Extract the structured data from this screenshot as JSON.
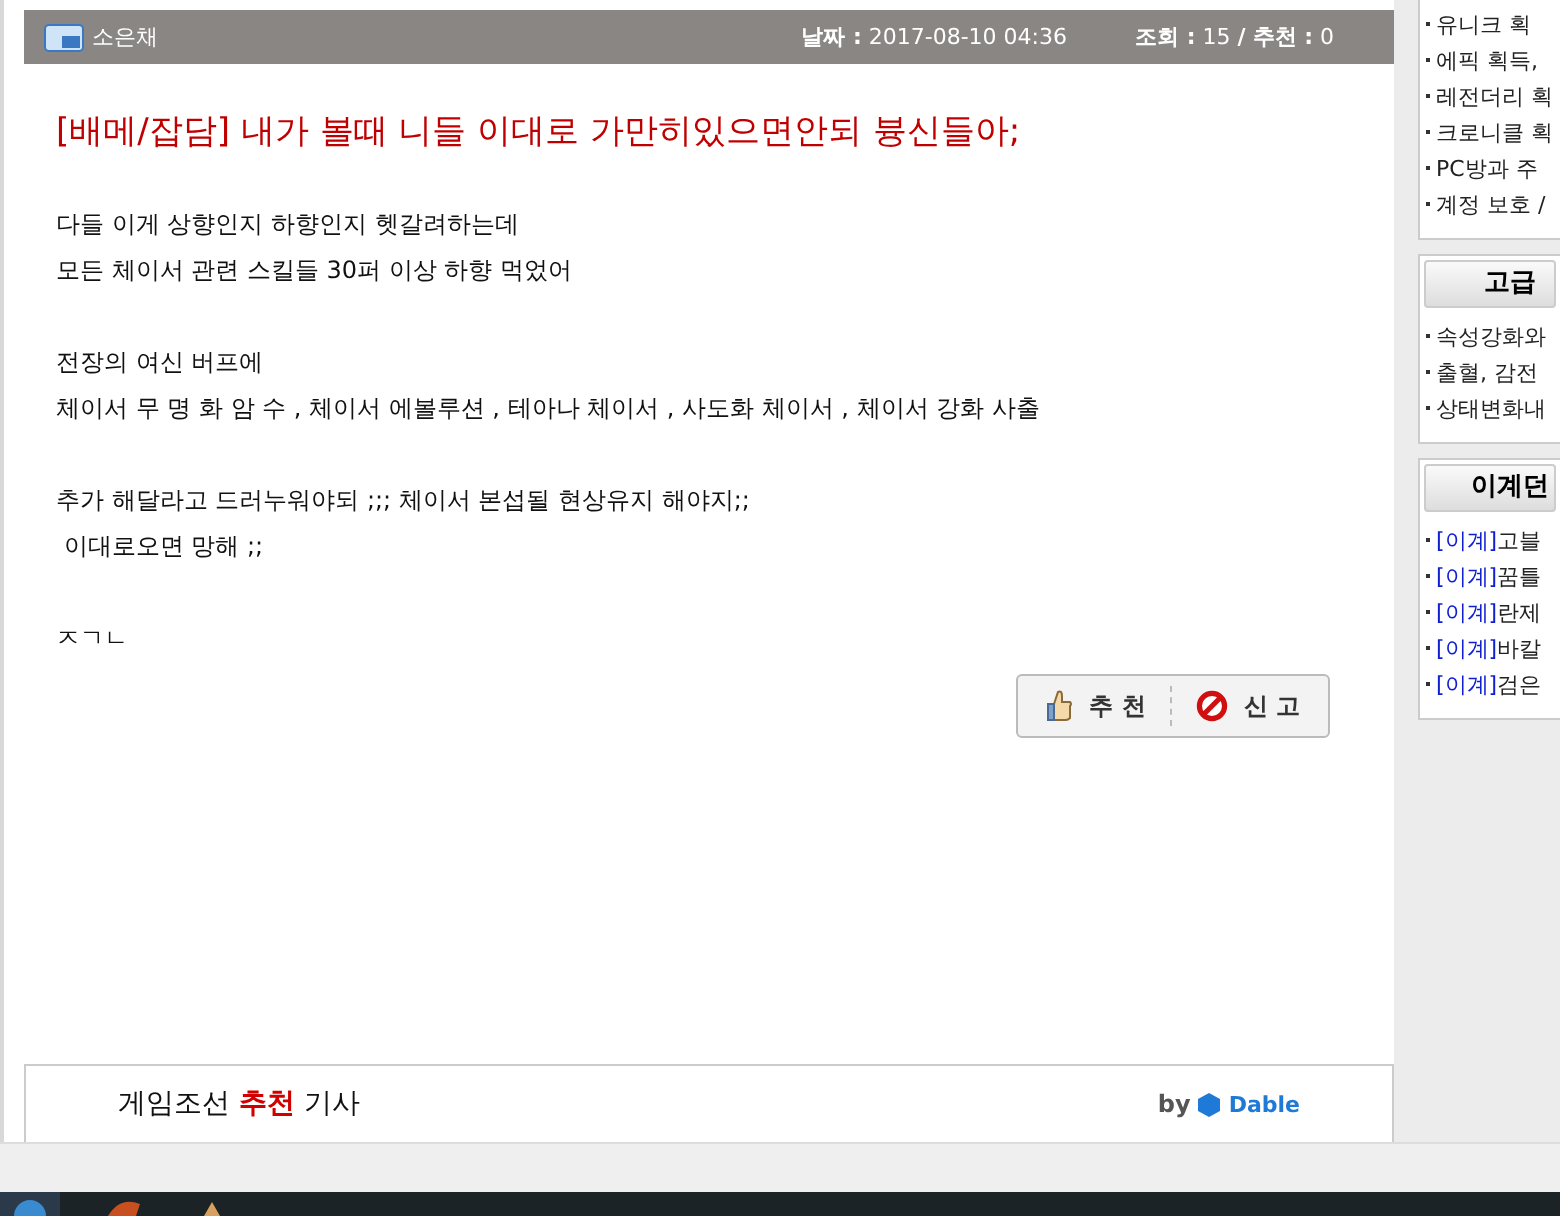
{
  "post": {
    "author": "소은채",
    "date_label": "날짜 :",
    "date": "2017-08-10 04:36",
    "views_label": "조회 :",
    "views": "15",
    "separator": "/",
    "recommend_label": "추천 :",
    "recommends": "0",
    "title": "[배메/잡담] 내가 볼때 니들 이대로 가만히있으면안되 븅신들아;",
    "paragraphs": [
      [
        "다들 이게 상향인지 하향인지 헷갈려하는데",
        "모든 체이서 관련 스킬들 30퍼 이상 하향 먹었어"
      ],
      [
        "전장의 여신 버프에",
        "체이서 무 명 화 암 수 , 체이서 에볼루션 , 테아나 체이서 , 사도화 체이서 , 체이서 강화 사출"
      ],
      [
        "추가 해달라고 드러누워야되 ;;; 체이서 본섭될 현상유지 해야지;;",
        " 이대로오면 망해 ;;"
      ],
      [
        "ㅈㄱㄴ"
      ]
    ],
    "buttons": [
      {
        "kind": "recommend",
        "label": "추 천"
      },
      {
        "kind": "report",
        "label": "신 고"
      }
    ]
  },
  "recommend_box": {
    "title": "게임조선",
    "highlight": "추천",
    "suffix": "기사",
    "by": "by",
    "brand": "Dable"
  },
  "sidebar": [
    {
      "items": [
        {
          "text": "유니크 획"
        },
        {
          "text": "에픽 획득,"
        },
        {
          "text": "레전더리 획"
        },
        {
          "text": "크로니클 획"
        },
        {
          "text": "PC방과 주"
        },
        {
          "text": "계정 보호 /"
        }
      ]
    },
    {
      "header": "고급",
      "items": [
        {
          "text": "속성강화와"
        },
        {
          "text": "출혈, 감전"
        },
        {
          "text": "상태변화내"
        }
      ]
    },
    {
      "header": "이계던",
      "items": [
        {
          "tag": "[이계]",
          "text": "고블"
        },
        {
          "tag": "[이계]",
          "text": "꿈틀"
        },
        {
          "tag": "[이계]",
          "text": "란제"
        },
        {
          "tag": "[이계]",
          "text": "바칼"
        },
        {
          "tag": "[이계]",
          "text": "검은"
        }
      ]
    }
  ]
}
